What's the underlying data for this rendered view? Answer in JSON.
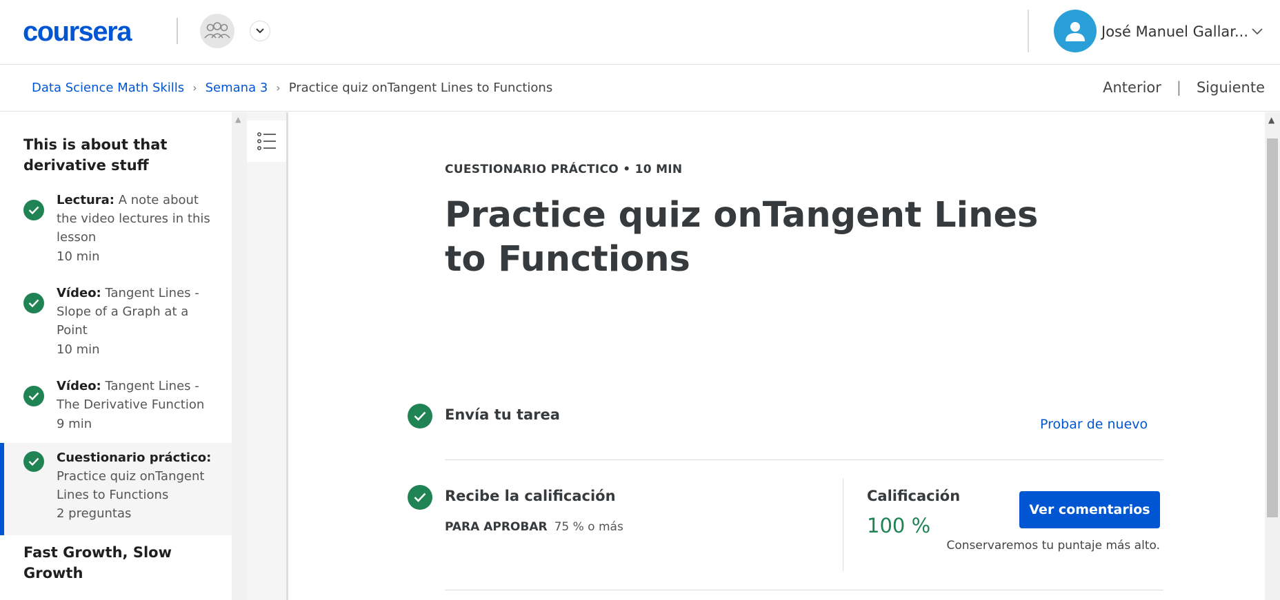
{
  "header": {
    "logo_text": "coursera",
    "user_name": "José Manuel Gallar..."
  },
  "breadcrumb": {
    "items": [
      "Data Science Math Skills",
      "Semana 3"
    ],
    "current": "Practice quiz onTangent Lines to Functions",
    "prev_label": "Anterior",
    "divider": "|",
    "next_label": "Siguiente"
  },
  "sidebar": {
    "section_title": "This is about that derivative stuff",
    "items": [
      {
        "type": "Lectura:",
        "title": "A note about the video lectures in this lesson",
        "duration": "10 min"
      },
      {
        "type": "Vídeo:",
        "title": "Tangent Lines - Slope of a Graph at a Point",
        "duration": "10 min"
      },
      {
        "type": "Vídeo:",
        "title": "Tangent Lines - The Derivative Function",
        "duration": "9 min"
      },
      {
        "type": "Cuestionario práctico:",
        "title": "Practice quiz onTangent Lines to Functions",
        "duration": "2 preguntas"
      }
    ],
    "next_section_title": "Fast Growth, Slow Growth"
  },
  "main": {
    "kicker": "CUESTIONARIO PRÁCTICO • 10 MIN",
    "title": "Practice quiz onTangent Lines to Functions",
    "submit_label": "Envía tu tarea",
    "retry_label": "Probar de nuevo",
    "receive_label": "Recibe la calificación",
    "pass_label": "PARA APROBAR",
    "pass_value": "75 % o más",
    "grade_label": "Calificación",
    "grade_value": "100 %",
    "feedback_button": "Ver comentarios",
    "keep_note": "Conservaremos tu puntaje más alto."
  },
  "colors": {
    "brand": "#0056d2",
    "success": "#1f8354",
    "avatar": "#2a9fd8"
  }
}
